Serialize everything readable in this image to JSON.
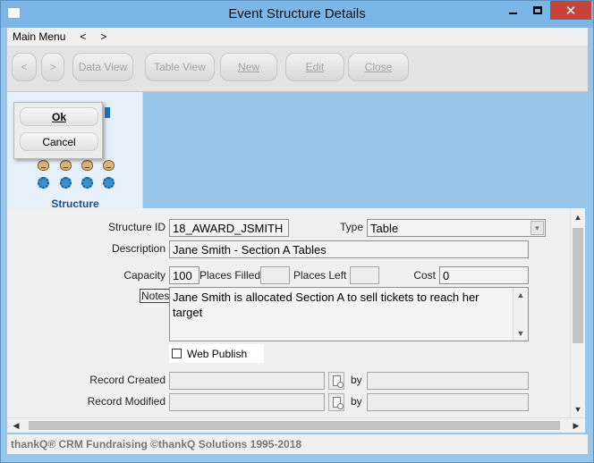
{
  "window": {
    "title": "Event Structure Details",
    "controls": {
      "minimize": "minimize-icon",
      "maximize": "maximize-icon",
      "close": "✕"
    }
  },
  "menu": {
    "main": "Main Menu",
    "back": "<",
    "forward": ">"
  },
  "toolbar": {
    "back": "<",
    "forward": ">",
    "data_view": "Data View",
    "table_view": "Table View",
    "new": "New",
    "edit": "Edit",
    "close": "Close"
  },
  "popup": {
    "ok": "Ok",
    "cancel": "Cancel"
  },
  "left_panel": {
    "label": "Structure"
  },
  "form": {
    "structure_id": {
      "label": "Structure ID",
      "value": "18_AWARD_JSMITH"
    },
    "type": {
      "label": "Type",
      "value": "Table"
    },
    "description": {
      "label": "Description",
      "value": "Jane Smith - Section A Tables"
    },
    "capacity": {
      "label": "Capacity",
      "value": "100"
    },
    "places_filled": {
      "label": "Places Filled",
      "value": ""
    },
    "places_left": {
      "label": "Places Left",
      "value": ""
    },
    "cost": {
      "label": "Cost",
      "value": "0"
    },
    "notes": {
      "label": "Notes",
      "value": "Jane Smith is allocated Section A to sell tickets to reach her target"
    },
    "web_publish": {
      "label": "Web Publish",
      "checked": false
    },
    "record_created": {
      "label": "Record Created",
      "value": "",
      "by_label": "by",
      "by_value": ""
    },
    "record_modified": {
      "label": "Record Modified",
      "value": "",
      "by_label": "by",
      "by_value": ""
    }
  },
  "footer": {
    "text": "thankQ® CRM Fundraising ©thankQ Solutions 1995-2018"
  },
  "colors": {
    "title_bar": "#7cb6e6",
    "background": "#98c6ea",
    "close_button": "#c7433b",
    "panel_label": "#1c4f88"
  }
}
